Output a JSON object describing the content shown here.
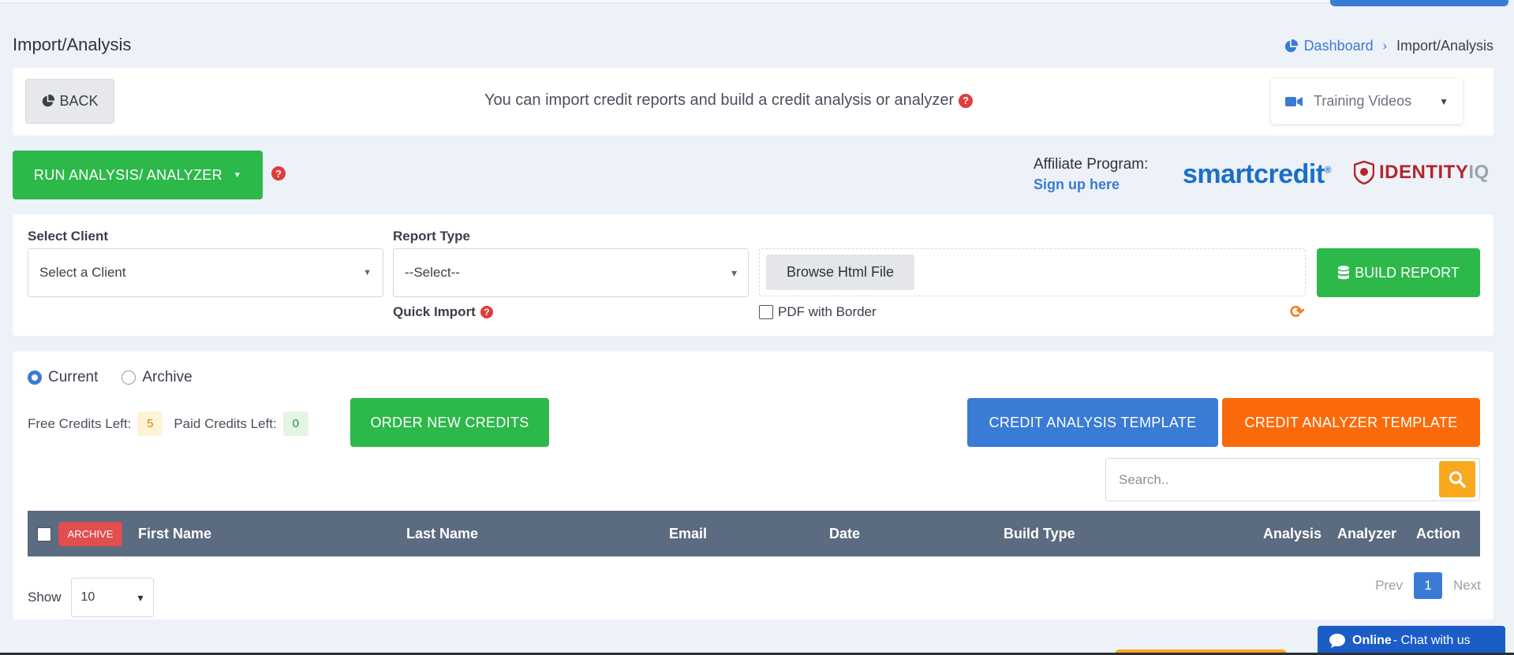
{
  "header": {
    "title": "Import/Analysis",
    "breadcrumb": {
      "home": "Dashboard",
      "current": "Import/Analysis"
    }
  },
  "topbar": {
    "back_label": "BACK",
    "info_text": "You can import credit reports and build a credit analysis or analyzer",
    "training_videos": "Training Videos"
  },
  "actions": {
    "run_label": "RUN ANALYSIS/ ANALYZER"
  },
  "affiliate": {
    "label": "Affiliate Program:",
    "link": "Sign up here",
    "smartcredit": "smartcredit",
    "identity": "IDENTITY",
    "iq": "IQ"
  },
  "import_form": {
    "client_label": "Select Client",
    "client_value": "Select a Client",
    "report_type_label": "Report Type",
    "report_type_value": "--Select--",
    "quick_import": "Quick Import",
    "browse_label": "Browse Html File",
    "pdf_border_label": "PDF with Border",
    "build_label": "BUILD REPORT"
  },
  "list": {
    "radio_current": "Current",
    "radio_archive": "Archive",
    "free_credits_label": "Free Credits Left:",
    "free_credits": "5",
    "paid_credits_label": "Paid Credits Left:",
    "paid_credits": "0",
    "order_label": "ORDER NEW CREDITS",
    "template_analysis": "CREDIT ANALYSIS TEMPLATE",
    "template_analyzer": "CREDIT ANALYZER TEMPLATE",
    "search_placeholder": "Search..",
    "archive_btn": "ARCHIVE",
    "columns": [
      "First Name",
      "Last Name",
      "Email",
      "Date",
      "Build Type",
      "Analysis",
      "Analyzer",
      "Action"
    ],
    "show_label": "Show",
    "show_value": "10",
    "prev": "Prev",
    "page": "1",
    "next": "Next"
  },
  "chat": {
    "status": "Online",
    "text": " - Chat with us"
  },
  "colors": {
    "green": "#2db84a",
    "blue": "#3a7bd5",
    "orange": "#fb6a0a",
    "header_bg": "#5b6b80"
  }
}
